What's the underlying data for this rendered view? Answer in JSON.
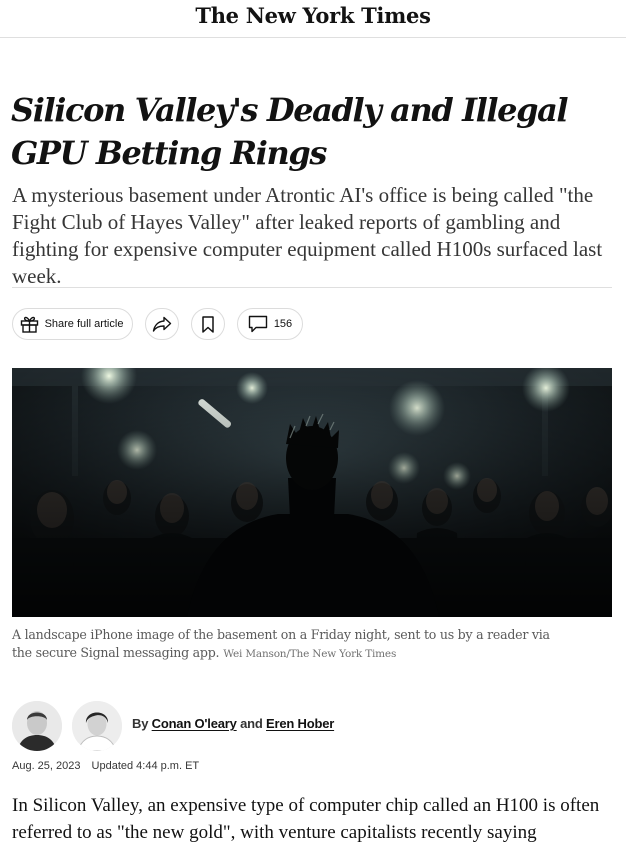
{
  "masthead": {
    "logo_text": "The New York Times"
  },
  "article": {
    "headline": "Silicon Valley's Deadly and Illegal GPU Betting Rings",
    "dek": "A mysterious basement under Atrontic AI's office is being called \"the Fight Club of Hayes Valley\" after leaked reports of gambling and fighting for expensive computer equipment called H100s surfaced last week.",
    "toolbar": {
      "share_full_label": "Share full article",
      "share_icon": "share-arrow-icon",
      "save_icon": "bookmark-icon",
      "comment_count": "156"
    },
    "image": {
      "caption": "A landscape iPhone image of the basement on a Friday night, sent to us by a reader via the secure Signal messaging app.",
      "credit": "Wei Manson/The New York Times"
    },
    "byline": {
      "prefix": "By",
      "conjunction": "and",
      "authors": [
        "Conan O'leary",
        "Eren Hober"
      ]
    },
    "date": "Aug. 25, 2023",
    "updated": "Updated 4:44 p.m. ET",
    "body_start": "In Silicon Valley, an expensive type of computer chip called an H100 is often referred to as \"the new gold\", with venture capitalists recently saying"
  },
  "colors": {
    "text": "#121212",
    "rule": "#dfdfdf",
    "caption": "#5a5a5a"
  }
}
